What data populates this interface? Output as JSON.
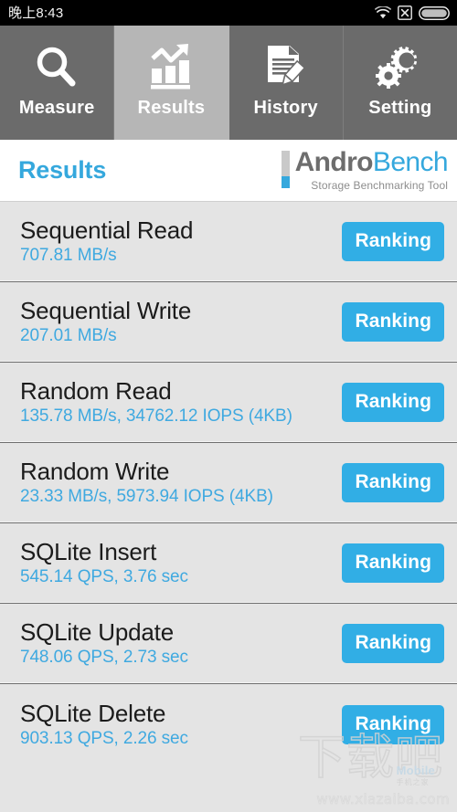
{
  "statusbar": {
    "time": "晚上8:43",
    "icons": [
      "wifi-icon",
      "no-signal-icon",
      "battery-icon"
    ]
  },
  "tabs": [
    {
      "label": "Measure",
      "icon": "magnifier-icon",
      "active": false
    },
    {
      "label": "Results",
      "icon": "bar-chart-trend-icon",
      "active": true
    },
    {
      "label": "History",
      "icon": "document-pencil-icon",
      "active": false
    },
    {
      "label": "Setting",
      "icon": "gears-icon",
      "active": false
    }
  ],
  "header": {
    "title": "Results",
    "logo": {
      "name_part1": "Andro",
      "name_part2": "Bench",
      "subtitle": "Storage Benchmarking Tool"
    }
  },
  "results": {
    "rows": [
      {
        "title": "Sequential Read",
        "value": "707.81 MB/s",
        "button": "Ranking"
      },
      {
        "title": "Sequential Write",
        "value": "207.01 MB/s",
        "button": "Ranking"
      },
      {
        "title": "Random Read",
        "value": "135.78 MB/s, 34762.12 IOPS (4KB)",
        "button": "Ranking"
      },
      {
        "title": "Random Write",
        "value": "23.33 MB/s, 5973.94 IOPS (4KB)",
        "button": "Ranking"
      },
      {
        "title": "SQLite Insert",
        "value": "545.14 QPS, 3.76 sec",
        "button": "Ranking"
      },
      {
        "title": "SQLite Update",
        "value": "748.06 QPS, 2.73 sec",
        "button": "Ranking"
      },
      {
        "title": "SQLite Delete",
        "value": "903.13 QPS, 2.26 sec",
        "button": "Ranking"
      }
    ]
  },
  "watermark": {
    "cn": "下载吧",
    "brand": "Mobile",
    "brand_sub": "手机之家",
    "url": "www.xiazaiba.com"
  },
  "colors": {
    "accent_blue": "#35a8dd",
    "button_blue": "#31aee5",
    "tab_inactive": "#6b6b6b",
    "tab_active": "#b6b6b6",
    "list_bg": "#e4e4e4"
  }
}
